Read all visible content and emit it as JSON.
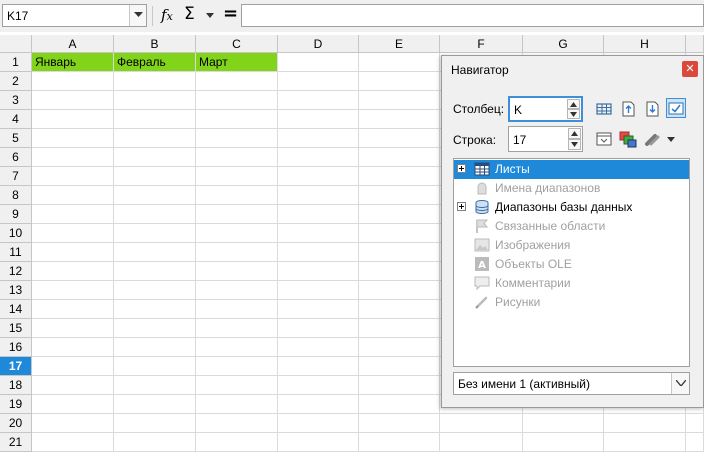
{
  "formula_bar": {
    "name_box": "K17",
    "function_wizard_icon": "fx-icon",
    "sum_icon": "sigma-icon",
    "equals_icon": "equals-icon",
    "formula": ""
  },
  "columns": [
    "A",
    "B",
    "C",
    "D",
    "E",
    "F",
    "G",
    "H"
  ],
  "rows": [
    "1",
    "2",
    "3",
    "4",
    "5",
    "6",
    "7",
    "8",
    "9",
    "10",
    "11",
    "12",
    "13",
    "14",
    "15",
    "16",
    "17",
    "18",
    "19",
    "20",
    "21"
  ],
  "active_row": "17",
  "cells": {
    "A1": "Январь",
    "B1": "Февраль",
    "C1": "Март"
  },
  "colors": {
    "highlight_fill": "#81d41a",
    "selection_blue": "#1e88d9"
  },
  "navigator": {
    "title": "Навигатор",
    "close_icon": "close-icon",
    "column_label": "Столбец:",
    "column_value": "K",
    "row_label": "Строка:",
    "row_value": "17",
    "tree": [
      {
        "label": "Листы",
        "icon": "sheet-icon",
        "expandable": true,
        "selected": true,
        "enabled": true
      },
      {
        "label": "Имена диапазонов",
        "icon": "range-name-icon",
        "expandable": false,
        "selected": false,
        "enabled": false
      },
      {
        "label": "Диапазоны базы данных",
        "icon": "database-icon",
        "expandable": true,
        "selected": false,
        "enabled": true
      },
      {
        "label": "Связанные области",
        "icon": "linked-area-icon",
        "expandable": false,
        "selected": false,
        "enabled": false
      },
      {
        "label": "Изображения",
        "icon": "image-icon",
        "expandable": false,
        "selected": false,
        "enabled": false
      },
      {
        "label": "Объекты OLE",
        "icon": "ole-icon",
        "expandable": false,
        "selected": false,
        "enabled": false
      },
      {
        "label": "Комментарии",
        "icon": "comment-icon",
        "expandable": false,
        "selected": false,
        "enabled": false
      },
      {
        "label": "Рисунки",
        "icon": "drawing-icon",
        "expandable": false,
        "selected": false,
        "enabled": false
      }
    ],
    "document": "Без имени 1 (активный)"
  }
}
